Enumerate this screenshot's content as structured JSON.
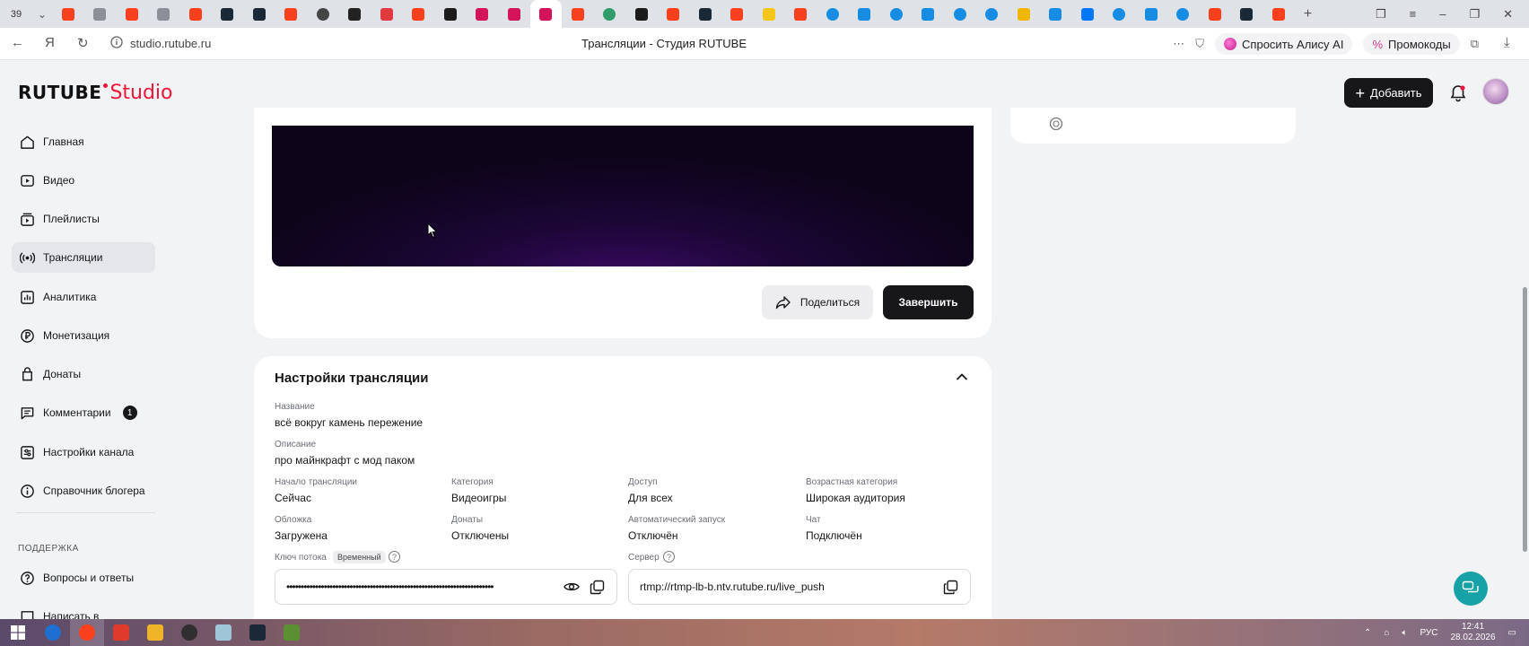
{
  "browser": {
    "tab_count": "39",
    "url": "studio.rutube.ru",
    "page_title": "Трансляции - Студия RUTUBE",
    "alisa_label": "Спросить Алису AI",
    "promo_label": "Промокоды",
    "tab_favicons": [
      {
        "icon": "yandex-icon",
        "color": "#fc3f1d"
      },
      {
        "icon": "doc-icon",
        "color": "#8a8f98"
      },
      {
        "icon": "yandex-icon",
        "color": "#fc3f1d"
      },
      {
        "icon": "doc-icon",
        "color": "#8a8f98"
      },
      {
        "icon": "yandex-icon",
        "color": "#fc3f1d"
      },
      {
        "icon": "steam-icon",
        "color": "#1b2838"
      },
      {
        "icon": "steam-icon",
        "color": "#1b2838"
      },
      {
        "icon": "yandex-icon",
        "color": "#fc3f1d"
      },
      {
        "icon": "smile-icon",
        "color": "#444444"
      },
      {
        "icon": "id-icon",
        "color": "#222222"
      },
      {
        "icon": "red-shape-icon",
        "color": "#e0393e"
      },
      {
        "icon": "yandex-icon",
        "color": "#fc3f1d"
      },
      {
        "icon": "rutube-icon",
        "color": "#1b1b1b"
      },
      {
        "icon": "s-icon",
        "color": "#d4145a"
      },
      {
        "icon": "s-icon",
        "color": "#d4145a"
      },
      {
        "icon": "s-icon",
        "color": "#d4145a"
      },
      {
        "icon": "yandex-icon",
        "color": "#fc3f1d"
      },
      {
        "icon": "green-circle-icon",
        "color": "#2f9e6a"
      },
      {
        "icon": "rutube-icon",
        "color": "#1b1b1b"
      },
      {
        "icon": "yandex-icon",
        "color": "#fc3f1d"
      },
      {
        "icon": "steam-icon",
        "color": "#1b2838"
      },
      {
        "icon": "yandex-icon",
        "color": "#fc3f1d"
      },
      {
        "icon": "star-icon",
        "color": "#f5c518"
      },
      {
        "icon": "yandex-icon",
        "color": "#fc3f1d"
      },
      {
        "icon": "at-icon",
        "color": "#168de2"
      },
      {
        "icon": "blue-square-icon",
        "color": "#168de2"
      },
      {
        "icon": "at-icon",
        "color": "#168de2"
      },
      {
        "icon": "mail-icon",
        "color": "#168de2"
      },
      {
        "icon": "at-icon",
        "color": "#168de2"
      },
      {
        "icon": "at-icon",
        "color": "#168de2"
      },
      {
        "icon": "yellow-icon",
        "color": "#f2b705"
      },
      {
        "icon": "blue-square-icon",
        "color": "#168de2"
      },
      {
        "icon": "vk-icon",
        "color": "#0077ff"
      },
      {
        "icon": "at-icon",
        "color": "#168de2"
      },
      {
        "icon": "chat-icon",
        "color": "#168de2"
      },
      {
        "icon": "at-icon",
        "color": "#168de2"
      },
      {
        "icon": "yandex-icon",
        "color": "#fc3f1d"
      },
      {
        "icon": "steam-icon",
        "color": "#1b2838"
      },
      {
        "icon": "yandex-icon",
        "color": "#fc3f1d"
      }
    ]
  },
  "header": {
    "logo_rutube": "RUTUBE",
    "logo_studio": "Studio",
    "add_label": "Добавить"
  },
  "sidebar": {
    "items": [
      {
        "label": "Главная",
        "icon": "home-icon"
      },
      {
        "label": "Видео",
        "icon": "video-icon"
      },
      {
        "label": "Плейлисты",
        "icon": "playlist-icon"
      },
      {
        "label": "Трансляции",
        "icon": "broadcast-icon",
        "active": true
      },
      {
        "label": "Аналитика",
        "icon": "analytics-icon"
      },
      {
        "label": "Монетизация",
        "icon": "ruble-icon"
      },
      {
        "label": "Донаты",
        "icon": "donate-icon"
      },
      {
        "label": "Комментарии",
        "icon": "comment-icon",
        "badge": "1"
      },
      {
        "label": "Настройки канала",
        "icon": "settings-icon"
      },
      {
        "label": "Справочник блогера",
        "icon": "info-icon"
      }
    ],
    "support_title": "ПОДДЕРЖКА",
    "support_items": [
      {
        "label": "Вопросы и ответы",
        "icon": "help-icon"
      },
      {
        "label": "Написать в",
        "icon": "message-icon"
      }
    ]
  },
  "stream": {
    "share_label": "Поделиться",
    "finish_label": "Завершить"
  },
  "settings": {
    "title": "Настройки трансляции",
    "name_label": "Название",
    "name_value": "всё вокруг камень пережение",
    "desc_label": "Описание",
    "desc_value": "про майнкрафт с мод паком",
    "start_label": "Начало трансляции",
    "start_value": "Сейчас",
    "category_label": "Категория",
    "category_value": "Видеоигры",
    "access_label": "Доступ",
    "access_value": "Для всех",
    "age_label": "Возрастная категория",
    "age_value": "Широкая аудитория",
    "cover_label": "Обложка",
    "cover_value": "Загружена",
    "donations_label": "Донаты",
    "donations_value": "Отключены",
    "autostart_label": "Автоматический запуск",
    "autostart_value": "Отключён",
    "chat_label": "Чат",
    "chat_value": "Подключён",
    "key_label": "Ключ потока",
    "key_tag": "Временный",
    "key_value": "••••••••••••••••••••••••••••••••••••••••••••••••••••••••••••••••••••••••",
    "server_label": "Сервер",
    "server_value": "rtmp://rtmp-lb-b.ntv.rutube.ru/live_push"
  },
  "taskbar": {
    "lang": "РУС",
    "time": "12:41",
    "date": "28.02.2026",
    "apps": [
      {
        "icon": "search-icon",
        "color": "#1f6fd1"
      },
      {
        "icon": "yandex-browser-icon",
        "color": "#fc3f1d"
      },
      {
        "icon": "yandex-icon",
        "color": "#e03a2d"
      },
      {
        "icon": "media-player-icon",
        "color": "#f0b429"
      },
      {
        "icon": "obs-icon",
        "color": "#302e31"
      },
      {
        "icon": "files-icon",
        "color": "#9fc6d8"
      },
      {
        "icon": "steam-icon",
        "color": "#1b2838"
      },
      {
        "icon": "minecraft-icon",
        "color": "#5a8f32"
      }
    ]
  }
}
